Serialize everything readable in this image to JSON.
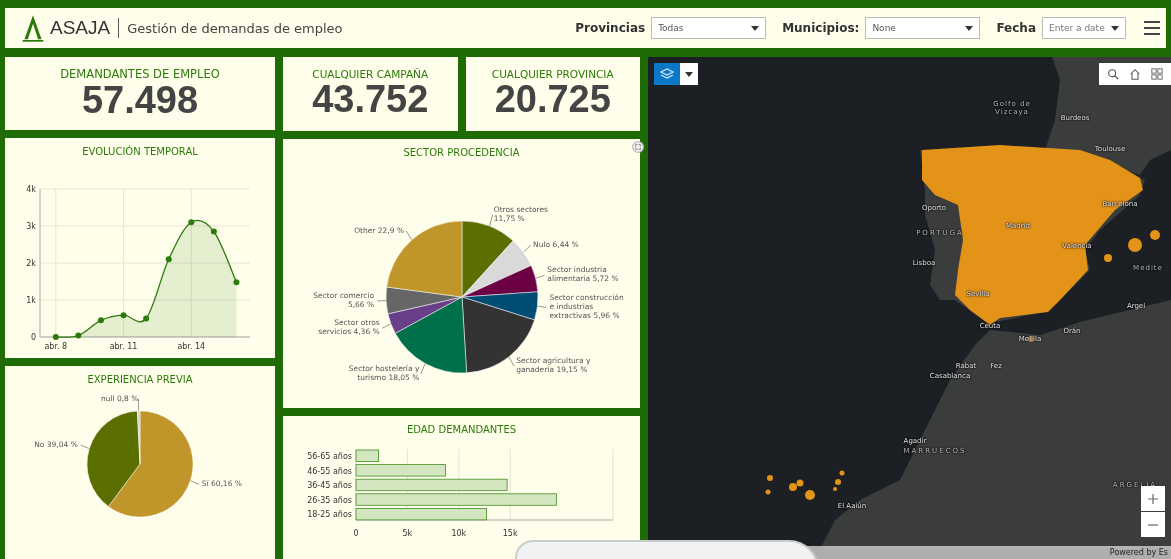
{
  "header": {
    "logo_text": "ASAJA",
    "title": "Gestión de demandas de empleo",
    "filters": [
      {
        "label": "Provincias",
        "kind": "select",
        "value": "Todas"
      },
      {
        "label": "Municipios:",
        "kind": "select",
        "value": "None"
      },
      {
        "label": "Fecha",
        "kind": "date",
        "placeholder": "Enter a date"
      }
    ]
  },
  "kpis": [
    {
      "label": "DEMANDANTES DE EMPLEO",
      "value": "57.498"
    },
    {
      "label": "CUALQUIER CAMPAÑA",
      "value": "43.752"
    },
    {
      "label": "CUALQUIER PROVINCIA",
      "value": "20.725"
    }
  ],
  "evolution": {
    "title": "EVOLUCIÓN TEMPORAL",
    "chart_data": {
      "type": "area",
      "grid": true,
      "x": [
        8,
        9,
        10,
        11,
        12,
        13,
        14,
        15,
        16
      ],
      "series": [
        {
          "color": "#2d7a0c",
          "values": [
            0,
            40,
            450,
            590,
            500,
            2100,
            3100,
            2850,
            1480
          ]
        }
      ],
      "xlim": [
        7.3,
        16.6
      ],
      "xticks": [
        {
          "value": 8,
          "label": "abr. 8"
        },
        {
          "value": 11,
          "label": "abr. 11"
        },
        {
          "value": 14,
          "label": "abr. 14"
        }
      ],
      "ylim": [
        0,
        4000
      ],
      "yticks": [
        {
          "value": 0,
          "label": "0"
        },
        {
          "value": 1000,
          "label": "1k"
        },
        {
          "value": 2000,
          "label": "2k"
        },
        {
          "value": 3000,
          "label": "3k"
        },
        {
          "value": 4000,
          "label": "4k"
        }
      ]
    }
  },
  "sector": {
    "title": "SECTOR PROCEDENCIA",
    "chart_data": {
      "type": "pie",
      "values": [
        11.75,
        6.44,
        5.72,
        5.96,
        19.15,
        18.05,
        4.36,
        5.66,
        22.9
      ],
      "colors": [
        "#5b6e00",
        "#d9d9d9",
        "#6b0042",
        "#004d73",
        "#333333",
        "#00704a",
        "#6a3f8a",
        "#666666",
        "#c0952a"
      ],
      "data_labels": true,
      "value_labels": [
        "Otros sectores 11,75 %",
        "Nulo 6,44 %",
        "Sector industria alimentaria 5,72 %",
        "Sector construcción e industrias extractivas 5,96 %",
        "Sector agricultura y ganadería 19,15 %",
        "Sector hostelería y turismo 18,05 %",
        "Sector otros servicios 4,36 %",
        "Sector comercio 5,66 %",
        "Other 22,9 %"
      ]
    }
  },
  "experience": {
    "title": "EXPERIENCIA PREVIA",
    "chart_data": {
      "type": "pie",
      "values": [
        60.16,
        39.04,
        0.8
      ],
      "colors": [
        "#c0952a",
        "#5b6e00",
        "#d0d0d0"
      ],
      "data_labels": true,
      "value_labels": [
        "Sí 60,16 %",
        "No 39,04 %",
        "null 0,8 %"
      ]
    }
  },
  "age": {
    "title": "EDAD DEMANDANTES",
    "chart_data": {
      "type": "bar",
      "orientation": "horizontal",
      "grid": true,
      "categories": [
        "56-65 años",
        "46-55 años",
        "36-45 años",
        "26-35 años",
        "18-25 años"
      ],
      "values": [
        2200,
        8700,
        14700,
        19500,
        12700
      ],
      "xlim": [
        0,
        25000
      ],
      "xticks": [
        {
          "value": 0,
          "label": "0"
        },
        {
          "value": 5000,
          "label": "5k"
        },
        {
          "value": 10000,
          "label": "10k"
        },
        {
          "value": 15000,
          "label": "15k"
        }
      ]
    }
  },
  "map": {
    "labels": [
      {
        "text": "Golfo de Vizcaya",
        "kind": "sea"
      },
      {
        "text": "Burdeos",
        "kind": "city"
      },
      {
        "text": "Toulouse",
        "kind": "city"
      },
      {
        "text": "Oporto",
        "kind": "city"
      },
      {
        "text": "PORTUGA",
        "kind": "country"
      },
      {
        "text": "Lisboa",
        "kind": "city"
      },
      {
        "text": "Madrid",
        "kind": "city"
      },
      {
        "text": "Barcelona",
        "kind": "city"
      },
      {
        "text": "Valencia",
        "kind": "city"
      },
      {
        "text": "Sevilla",
        "kind": "city"
      },
      {
        "text": "Ceuta",
        "kind": "city"
      },
      {
        "text": "Melilla",
        "kind": "city"
      },
      {
        "text": "Orán",
        "kind": "city"
      },
      {
        "text": "Medite",
        "kind": "sea"
      },
      {
        "text": "Argel",
        "kind": "city"
      },
      {
        "text": "Rabat",
        "kind": "city"
      },
      {
        "text": "Fez",
        "kind": "city"
      },
      {
        "text": "Casablanca",
        "kind": "city"
      },
      {
        "text": "Agadir",
        "kind": "city"
      },
      {
        "text": "MARRUECOS",
        "kind": "country"
      },
      {
        "text": "El Aaiún",
        "kind": "city"
      },
      {
        "text": "ARGELIA",
        "kind": "country"
      }
    ],
    "attribution": "Powered by Es"
  }
}
